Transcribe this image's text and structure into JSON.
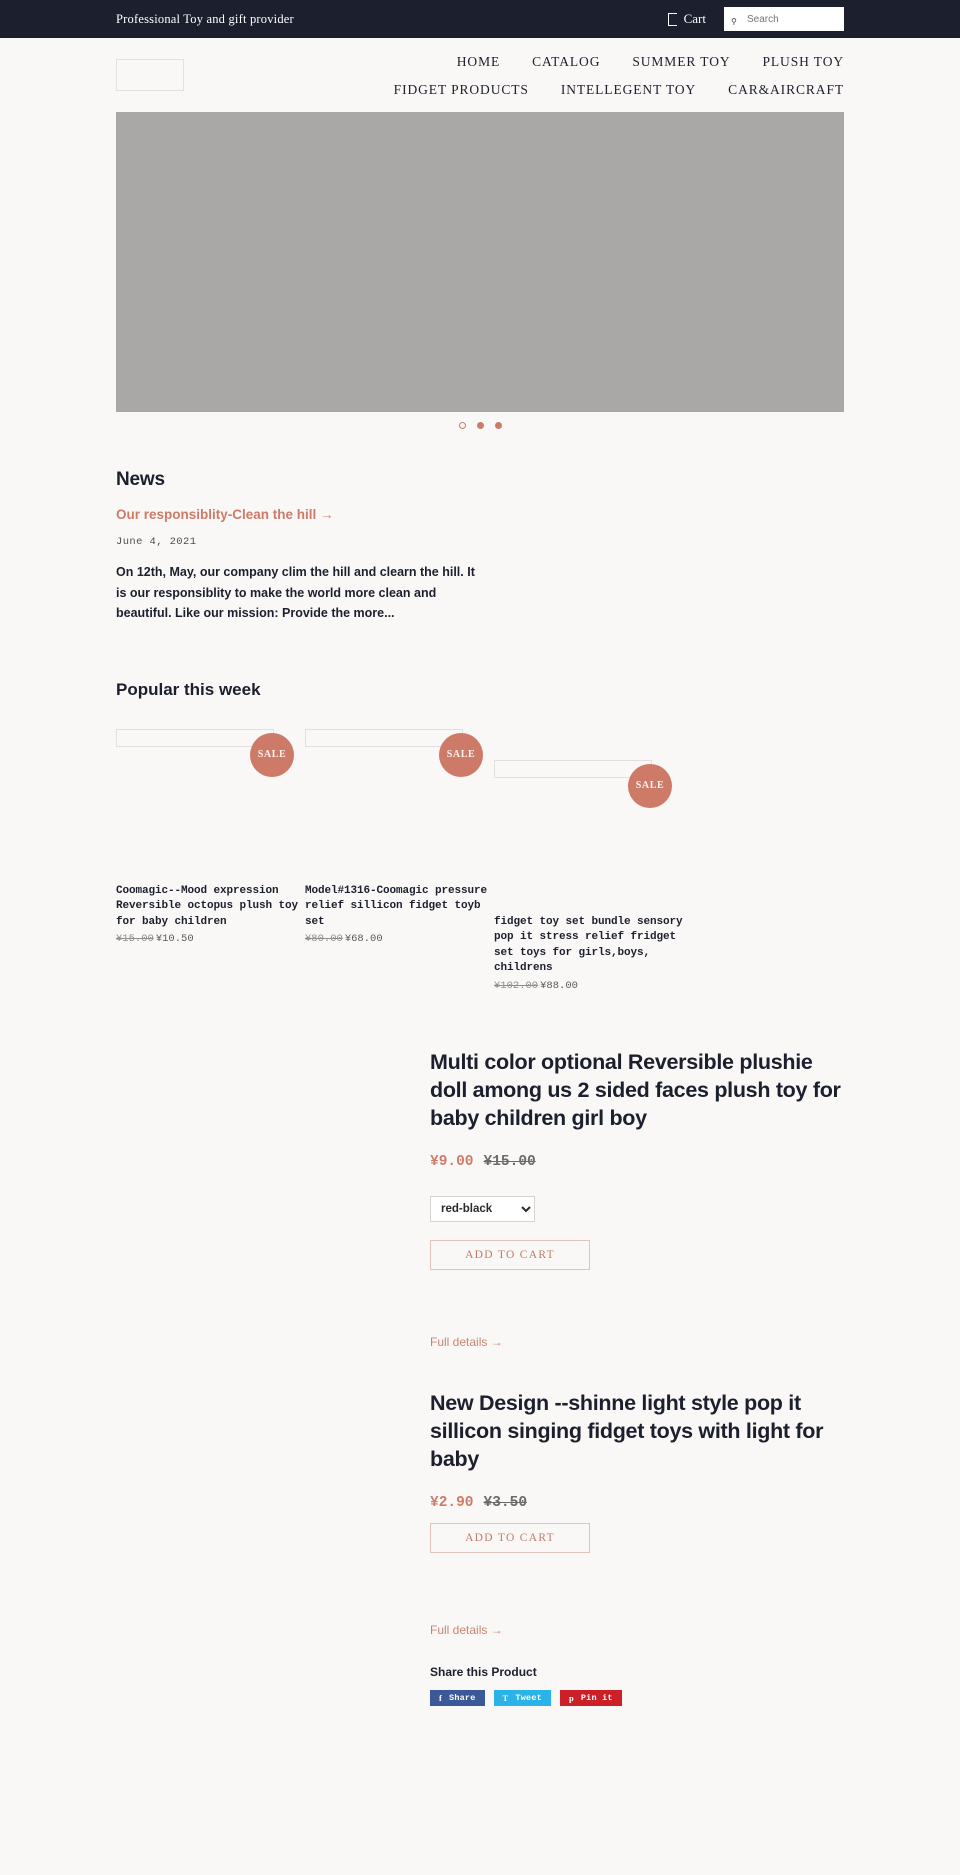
{
  "topbar": {
    "message": "Professional Toy and gift provider",
    "cart_label": "Cart",
    "cart_icon": "cart-icon",
    "search_placeholder": "Search",
    "search_value": "",
    "search_icon": "search-icon"
  },
  "header": {
    "logo_alt": "",
    "nav_row1": [
      {
        "label": "HOME"
      },
      {
        "label": "CATALOG"
      },
      {
        "label": "SUMMER TOY"
      },
      {
        "label": "PLUSH TOY"
      }
    ],
    "nav_row2": [
      {
        "label": "FIDGET PRODUCTS"
      },
      {
        "label": "INTELLEGENT TOY"
      },
      {
        "label": "CAR&AIRCRAFT"
      }
    ]
  },
  "hero": {
    "dots": [
      "open",
      "filled",
      "filled"
    ]
  },
  "news": {
    "heading": "News",
    "article_link": "Our responsiblity-Clean the hill →",
    "date": "June 4, 2021",
    "excerpt": "On 12th, May, our company clim the hill and clearn the hill. It is our responsiblity to make the world more clean and beautiful. Like our mission: Provide the more..."
  },
  "popular": {
    "heading": "Popular this week",
    "sale_badge": "SALE",
    "products": [
      {
        "title": "Coomagic--Mood expression Reversible octopus plush toy for baby children",
        "price_was": "¥15.00",
        "price_now": "¥10.50"
      },
      {
        "title": "Model#1316-Coomagic pressure relief sillicon fidget toyb set",
        "price_was": "¥80.00",
        "price_now": "¥68.00"
      },
      {
        "title": "fidget toy set bundle sensory pop it stress relief fridget set toys for girls,boys, childrens",
        "price_was": "¥102.00",
        "price_now": "¥88.00"
      }
    ]
  },
  "featured": [
    {
      "title": "Multi color optional Reversible plushie doll among us 2 sided faces plush toy for baby children girl boy",
      "price_sale": "¥9.00",
      "price_was": "¥15.00",
      "variant_selected": "red-black",
      "variant_options": [
        "red-black"
      ],
      "add_to_cart": "ADD TO CART",
      "full_details": "Full details →",
      "has_variant": true
    },
    {
      "title": "New Design --shinne light style pop it sillicon singing fidget toys with light for baby",
      "price_sale": "¥2.90",
      "price_was": "¥3.50",
      "variant_selected": "",
      "variant_options": [],
      "add_to_cart": "ADD TO CART",
      "full_details": "Full details →",
      "has_variant": false
    }
  ],
  "share": {
    "heading": "Share this Product",
    "buttons": [
      {
        "glyph": "f",
        "label": "Share",
        "icon": "facebook-icon"
      },
      {
        "glyph": "T",
        "label": "Tweet",
        "icon": "twitter-icon"
      },
      {
        "glyph": "p",
        "label": "Pin it",
        "icon": "pinterest-icon"
      }
    ]
  },
  "colors": {
    "accent": "#cd7b68",
    "dark": "#1c1f2e",
    "page_bg": "#faf8f6"
  }
}
